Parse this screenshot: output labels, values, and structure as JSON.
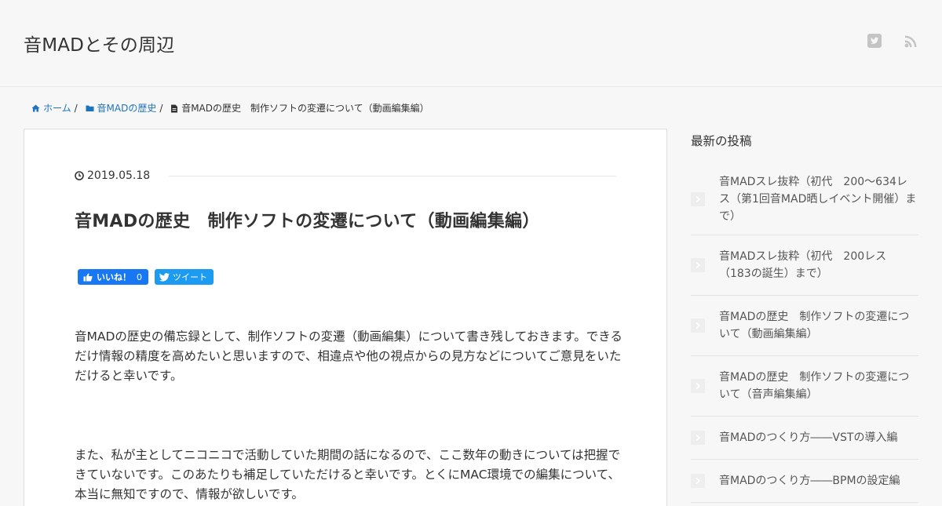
{
  "site": {
    "title": "音MADとその周辺"
  },
  "header": {
    "icons": [
      "twitter-icon",
      "rss-icon"
    ]
  },
  "breadcrumb": {
    "home": "ホーム",
    "category": "音MADの歴史",
    "current": "音MADの歴史　制作ソフトの変遷について（動画編集編）",
    "separator": "/"
  },
  "article": {
    "date": "2019.05.18",
    "title": "音MADの歴史　制作ソフトの変遷について（動画編集編）",
    "share": {
      "like_label": "いいね！",
      "like_count": "0",
      "tweet_label": "ツイート"
    },
    "paragraphs": [
      "音MADの歴史の備忘録として、制作ソフトの変遷（動画編集）について書き残しておきます。できるだけ情報の精度を高めたいと思いますので、相違点や他の視点からの見方などについてご意見をいただけると幸いです。",
      "また、私が主としてニコニコで活動していた期間の話になるので、ここ数年の動きについては把握できていないです。このあたりも補足していただけると幸いです。とくにMAC環境での編集について、本当に無知ですので、情報が欲しいです。"
    ]
  },
  "sidebar": {
    "widget_title": "最新の投稿",
    "recent_posts": [
      "音MADスレ抜粋（初代　200～634レス（第1回音MAD晒しイベント開催）まで）",
      "音MADスレ抜粋（初代　200レス（183の誕生）まで）",
      "音MADの歴史　制作ソフトの変遷について（動画編集編）",
      "音MADの歴史　制作ソフトの変遷について（音声編集編）",
      "音MADのつくり方――VSTの導入編",
      "音MADのつくり方――BPMの設定編"
    ]
  },
  "colors": {
    "link": "#1e73be",
    "facebook": "#1877f2",
    "twitter": "#1d9bf0",
    "icon_gray": "#c4c4c4"
  }
}
